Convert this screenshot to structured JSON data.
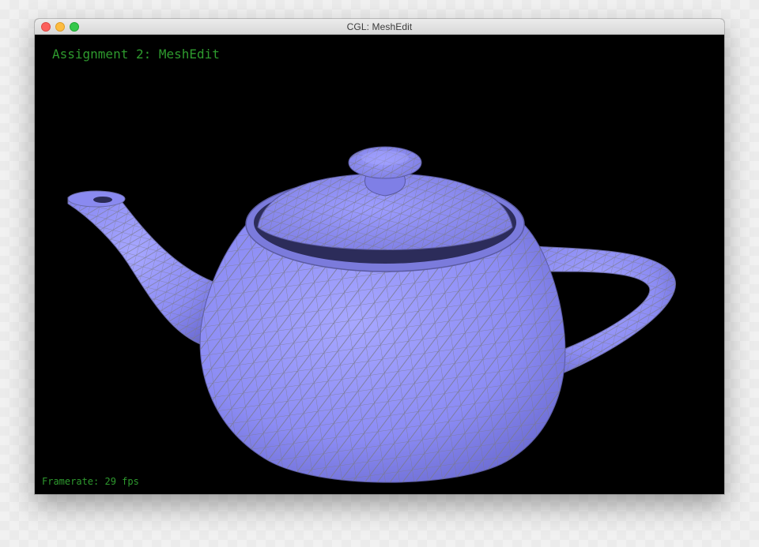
{
  "window": {
    "title": "CGL: MeshEdit"
  },
  "viewport": {
    "heading": "Assignment 2: MeshEdit",
    "framerate": "Framerate: 29 fps",
    "mesh_color": "#8f8fff",
    "wire_color": "#7a7a8a",
    "hud_color": "#2e9a2e"
  },
  "icons": [
    "close-button",
    "minimize-button",
    "zoom-button",
    "teapot-mesh"
  ]
}
